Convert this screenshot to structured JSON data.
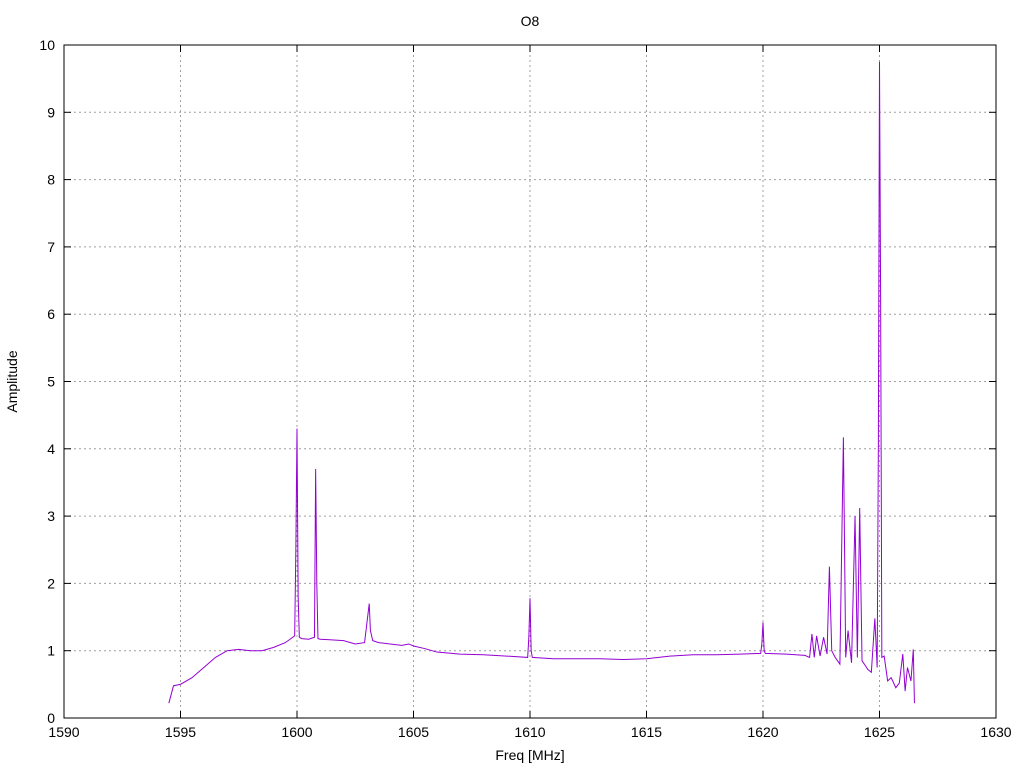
{
  "chart_data": {
    "type": "line",
    "title": "O8",
    "xlabel": "Freq [MHz]",
    "ylabel": "Amplitude",
    "xlim": [
      1590,
      1630
    ],
    "ylim": [
      0,
      10
    ],
    "xticks": [
      1590,
      1595,
      1600,
      1605,
      1610,
      1615,
      1620,
      1625,
      1630
    ],
    "yticks": [
      0,
      1,
      2,
      3,
      4,
      5,
      6,
      7,
      8,
      9,
      10
    ],
    "grid": true,
    "legend": "none",
    "series_color": "#9400d3",
    "series": [
      {
        "x": [
          1594.5,
          1594.7,
          1595.0,
          1595.5,
          1596.0,
          1596.5,
          1597.0,
          1597.5,
          1598.0,
          1598.5,
          1599.0,
          1599.5,
          1599.9,
          1599.95,
          1600.0,
          1600.05,
          1600.1,
          1600.2,
          1600.5,
          1600.75,
          1600.8,
          1600.85,
          1600.9,
          1601.0,
          1601.5,
          1602.0,
          1602.5,
          1602.9,
          1603.1,
          1603.15,
          1603.25,
          1603.5,
          1604.0,
          1604.5,
          1604.8,
          1605.0,
          1605.5,
          1606.0,
          1607.0,
          1608.0,
          1609.0,
          1609.9,
          1609.95,
          1610.0,
          1610.05,
          1610.1,
          1611.0,
          1612.0,
          1613.0,
          1614.0,
          1615.0,
          1616.0,
          1617.0,
          1618.0,
          1619.0,
          1619.9,
          1619.95,
          1620.0,
          1620.05,
          1620.1,
          1621.0,
          1621.8,
          1622.0,
          1622.1,
          1622.2,
          1622.3,
          1622.45,
          1622.6,
          1622.75,
          1622.85,
          1622.95,
          1623.1,
          1623.3,
          1623.45,
          1623.55,
          1623.65,
          1623.8,
          1623.95,
          1624.05,
          1624.15,
          1624.25,
          1624.35,
          1624.5,
          1624.65,
          1624.8,
          1624.9,
          1624.95,
          1625.0,
          1625.05,
          1625.1,
          1625.2,
          1625.35,
          1625.5,
          1625.7,
          1625.85,
          1626.0,
          1626.1,
          1626.2,
          1626.35,
          1626.45,
          1626.5
        ],
        "y": [
          0.22,
          0.48,
          0.5,
          0.6,
          0.75,
          0.9,
          1.0,
          1.02,
          1.0,
          1.0,
          1.05,
          1.12,
          1.22,
          2.5,
          4.3,
          1.8,
          1.2,
          1.18,
          1.17,
          1.2,
          3.7,
          2.0,
          1.18,
          1.17,
          1.16,
          1.15,
          1.1,
          1.12,
          1.7,
          1.3,
          1.15,
          1.12,
          1.1,
          1.08,
          1.1,
          1.07,
          1.03,
          0.98,
          0.95,
          0.94,
          0.92,
          0.9,
          1.2,
          1.78,
          1.0,
          0.9,
          0.88,
          0.88,
          0.88,
          0.87,
          0.88,
          0.92,
          0.94,
          0.94,
          0.95,
          0.96,
          1.1,
          1.42,
          1.0,
          0.96,
          0.95,
          0.93,
          0.9,
          1.25,
          0.9,
          1.22,
          0.92,
          1.2,
          0.95,
          2.25,
          1.0,
          0.9,
          0.8,
          4.17,
          0.9,
          1.3,
          0.82,
          3.0,
          0.9,
          3.12,
          0.85,
          0.8,
          0.72,
          0.68,
          1.48,
          0.75,
          4.0,
          9.75,
          6.1,
          0.9,
          0.92,
          0.55,
          0.6,
          0.45,
          0.52,
          0.95,
          0.4,
          0.75,
          0.55,
          1.02,
          0.22
        ]
      }
    ]
  }
}
